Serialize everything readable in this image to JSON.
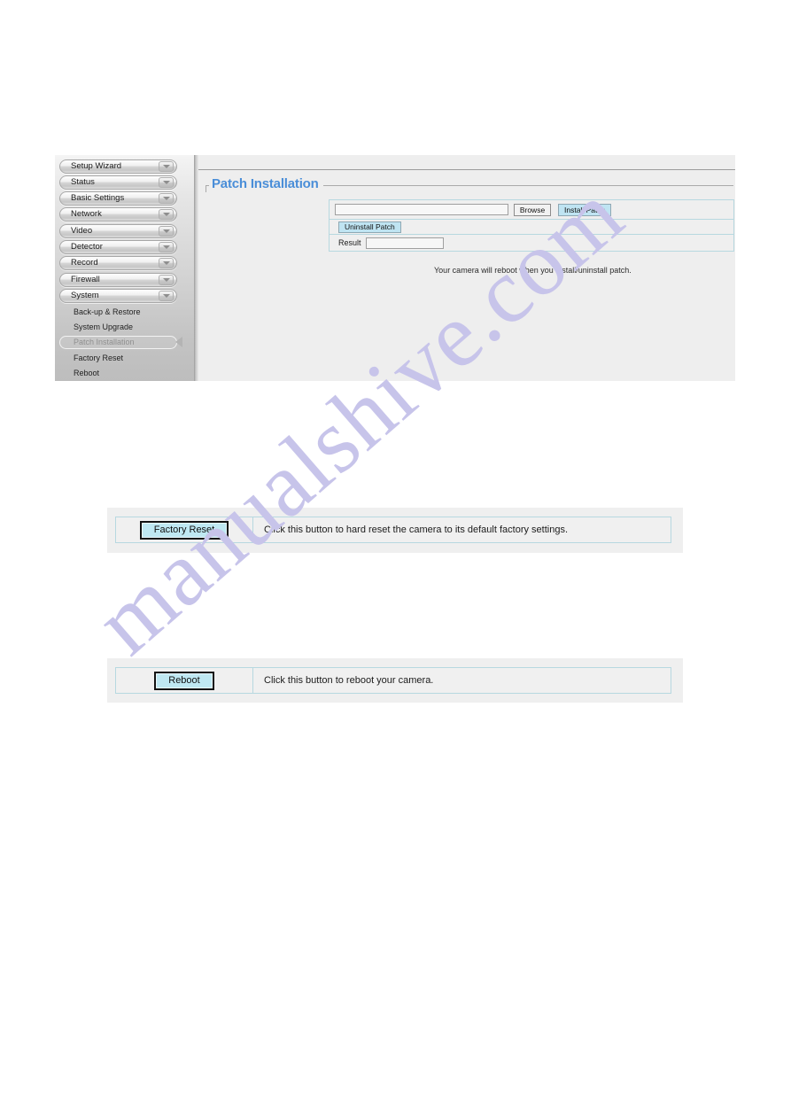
{
  "app": {
    "sidebar": {
      "groups": [
        {
          "label": "Setup Wizard",
          "icon": "chevron-down-icon"
        },
        {
          "label": "Status",
          "icon": "chevron-down-icon"
        },
        {
          "label": "Basic Settings",
          "icon": "chevron-down-icon"
        },
        {
          "label": "Network",
          "icon": "chevron-down-icon"
        },
        {
          "label": "Video",
          "icon": "chevron-down-icon"
        },
        {
          "label": "Detector",
          "icon": "chevron-down-icon"
        },
        {
          "label": "Record",
          "icon": "chevron-down-icon"
        },
        {
          "label": "Firewall",
          "icon": "chevron-down-icon"
        },
        {
          "label": "System",
          "icon": "chevron-down-icon"
        }
      ],
      "sub_items": [
        {
          "label": "Back-up & Restore",
          "selected": false
        },
        {
          "label": "System Upgrade",
          "selected": false
        },
        {
          "label": "Patch Installation",
          "selected": true
        },
        {
          "label": "Factory Reset",
          "selected": false
        },
        {
          "label": "Reboot",
          "selected": false
        }
      ],
      "selection_marker_icon": "left-triangle-icon"
    },
    "panel": {
      "title": "Patch Installation",
      "title_color": "#4a8ed8",
      "patch_path": {
        "value": "",
        "placeholder": ""
      },
      "browse_label": "Browse",
      "install_label": "Install Patch",
      "uninstall_label": "Uninstall Patch",
      "result_label": "Result",
      "result_value": "",
      "hint": "Your camera will reboot when you install/uninstall patch.",
      "accent_border": "#b7d8e0",
      "button_blue": "#bfe4f2"
    }
  },
  "factory_reset": {
    "button_label": "Factory Reset",
    "description": "Click this button to hard reset the camera to its default factory settings."
  },
  "reboot": {
    "button_label": "Reboot",
    "description": "Click this button to reboot your camera."
  },
  "watermark": {
    "text": "manualshive.com",
    "color": "#c7c4ea"
  }
}
